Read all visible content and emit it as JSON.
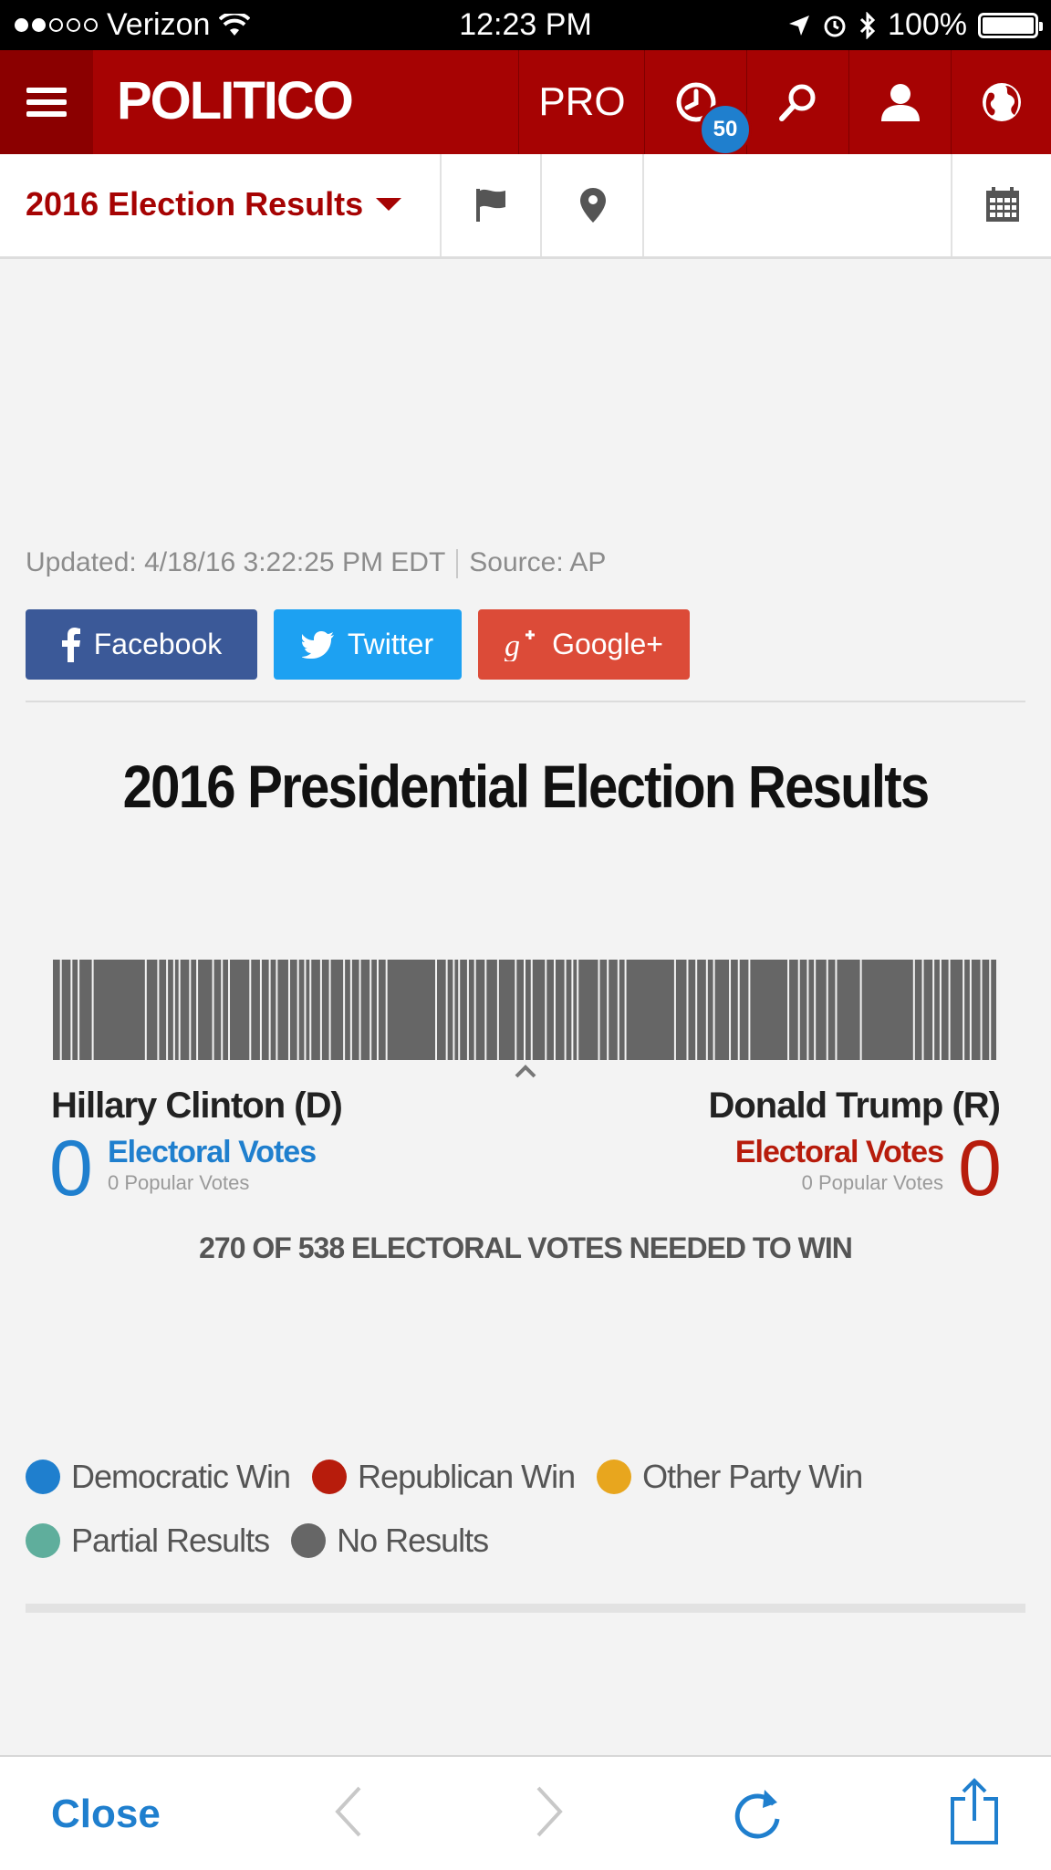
{
  "status_bar": {
    "carrier": "Verizon",
    "time": "12:23 PM",
    "battery": "100%"
  },
  "header": {
    "logo": "POLITICO",
    "pro_label": "PRO",
    "notification_count": "50",
    "icons": [
      "menu-icon",
      "clock-icon",
      "search-icon",
      "user-icon",
      "globe-icon"
    ],
    "brand_color": "#a60303"
  },
  "subnav": {
    "title": "2016 Election Results",
    "icons": [
      "flag-icon",
      "map-pin-icon",
      "calendar-icon"
    ]
  },
  "meta": {
    "updated": "Updated: 4/18/16 3:22:25 PM EDT",
    "source": "Source: AP"
  },
  "share": {
    "facebook": "Facebook",
    "twitter": "Twitter",
    "google": "Google+"
  },
  "main": {
    "title": "2016 Presidential Election Results",
    "needed": "270 OF 538 ELECTORAL VOTES NEEDED TO WIN"
  },
  "candidates": {
    "left": {
      "name": "Hillary Clinton (D)",
      "electoral": "0",
      "electoral_label": "Electoral Votes",
      "popular": "0 Popular Votes",
      "color": "#1f7fce"
    },
    "right": {
      "name": "Donald Trump (R)",
      "electoral": "0",
      "electoral_label": "Electoral Votes",
      "popular": "0 Popular Votes",
      "color": "#b71c0c"
    }
  },
  "legend": [
    {
      "label": "Democratic Win",
      "color": "#1f7fce"
    },
    {
      "label": "Republican Win",
      "color": "#b71c0c"
    },
    {
      "label": "Other Party Win",
      "color": "#e8a61e"
    },
    {
      "label": "Partial Results",
      "color": "#5fae9c"
    },
    {
      "label": "No Results",
      "color": "#666666"
    }
  ],
  "bottom_bar": {
    "close_label": "Close"
  }
}
